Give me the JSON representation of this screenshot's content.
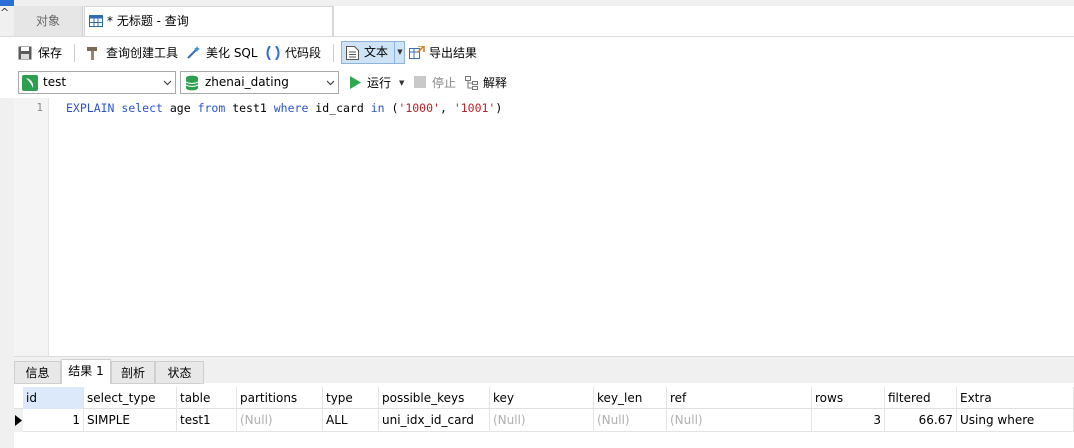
{
  "tabs": {
    "objects_label": "对象",
    "query_label": "* 无标题 - 查询"
  },
  "toolbar": {
    "save": "保存",
    "query_builder": "查询创建工具",
    "beautify": "美化 SQL",
    "code_snippet": "代码段",
    "text": "文本",
    "export": "导出结果"
  },
  "run_bar": {
    "connection": "test",
    "database": "zhenai_dating",
    "run": "运行",
    "stop": "停止",
    "explain": "解释"
  },
  "editor": {
    "line_number": "1",
    "tokens": [
      {
        "t": "EXPLAIN",
        "k": "kw"
      },
      {
        "t": " ",
        "k": ""
      },
      {
        "t": "select",
        "k": "kw"
      },
      {
        "t": " age ",
        "k": ""
      },
      {
        "t": "from",
        "k": "kw"
      },
      {
        "t": " test1 ",
        "k": ""
      },
      {
        "t": "where",
        "k": "kw"
      },
      {
        "t": " id_card ",
        "k": ""
      },
      {
        "t": "in",
        "k": "kw"
      },
      {
        "t": " (",
        "k": ""
      },
      {
        "t": "'1000'",
        "k": "str"
      },
      {
        "t": ", ",
        "k": ""
      },
      {
        "t": "'1001'",
        "k": "str"
      },
      {
        "t": ")",
        "k": ""
      }
    ]
  },
  "result_tabs": [
    "信息",
    "结果 1",
    "剖析",
    "状态"
  ],
  "grid": {
    "columns": [
      "id",
      "select_type",
      "table",
      "partitions",
      "type",
      "possible_keys",
      "key",
      "key_len",
      "ref",
      "rows",
      "filtered",
      "Extra"
    ],
    "rows": [
      [
        "1",
        "SIMPLE",
        "test1",
        "(Null)",
        "ALL",
        "uni_idx_id_card",
        "(Null)",
        "(Null)",
        "(Null)",
        "3",
        "66.67",
        "Using where"
      ]
    ]
  },
  "colors": {
    "keyword": "#2b55c9",
    "string": "#b5232b",
    "null_text": "#b0b0b0",
    "selected_header": "#dbe9fb"
  }
}
